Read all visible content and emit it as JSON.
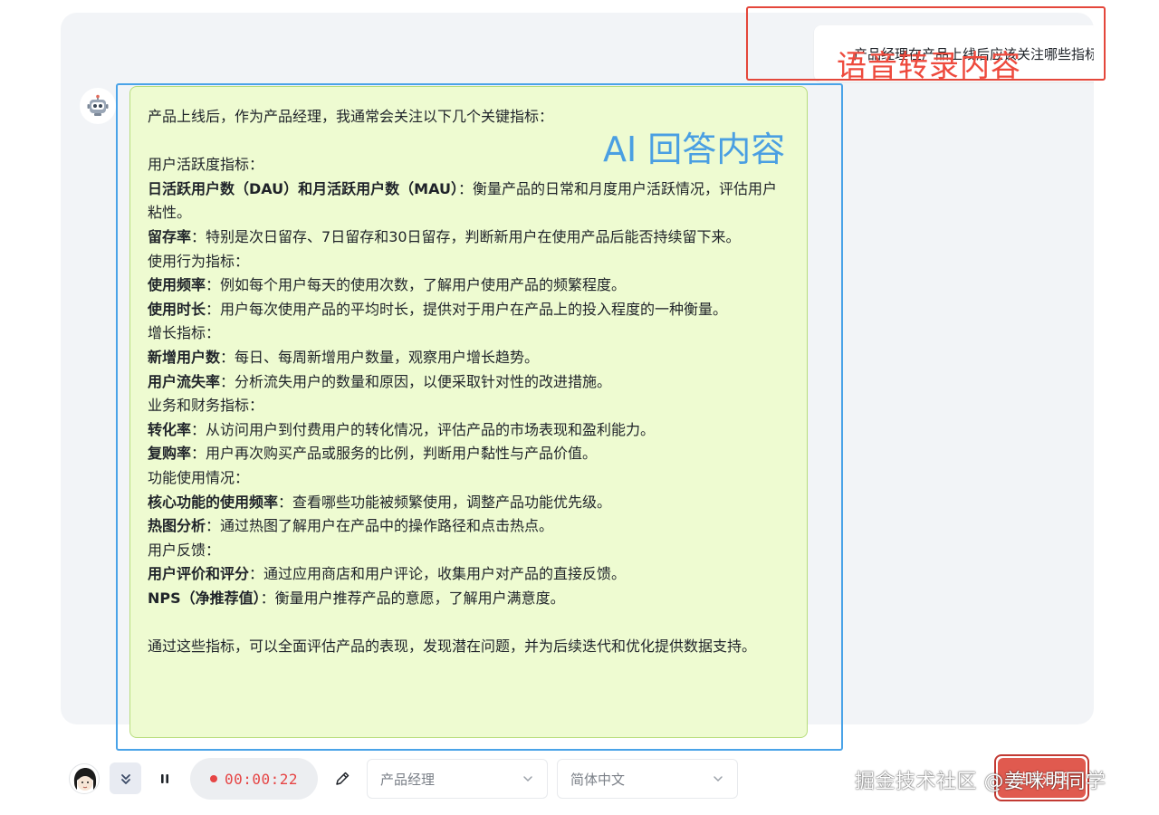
{
  "user_message": "产品经理在产品上线后应该关注哪些指标",
  "annotations": {
    "speech_label": "语音转录内容",
    "ai_label": "AI 回答内容",
    "speech_color": "#e4473b",
    "ai_color": "#4aa3e8"
  },
  "ai_answer": {
    "intro": "产品上线后，作为产品经理，我通常会关注以下几个关键指标：",
    "sections": [
      {
        "heading": "用户活跃度指标：",
        "items": [
          {
            "term": "日活跃用户数（DAU）和月活跃用户数（MAU）",
            "desc": "：衡量产品的日常和月度用户活跃情况，评估用户粘性。"
          },
          {
            "term": "留存率",
            "desc": "：特别是次日留存、7日留存和30日留存，判断新用户在使用产品后能否持续留下来。"
          }
        ]
      },
      {
        "heading": "使用行为指标：",
        "items": [
          {
            "term": "使用频率",
            "desc": "：例如每个用户每天的使用次数，了解用户使用产品的频繁程度。"
          },
          {
            "term": "使用时长",
            "desc": "：用户每次使用产品的平均时长，提供对于用户在产品上的投入程度的一种衡量。"
          }
        ]
      },
      {
        "heading": "增长指标：",
        "items": [
          {
            "term": "新增用户数",
            "desc": "：每日、每周新增用户数量，观察用户增长趋势。"
          },
          {
            "term": "用户流失率",
            "desc": "：分析流失用户的数量和原因，以便采取针对性的改进措施。"
          }
        ]
      },
      {
        "heading": "业务和财务指标：",
        "items": [
          {
            "term": "转化率",
            "desc": "：从访问用户到付费用户的转化情况，评估产品的市场表现和盈利能力。"
          },
          {
            "term": "复购率",
            "desc": "：用户再次购买产品或服务的比例，判断用户黏性与产品价值。"
          }
        ]
      },
      {
        "heading": "功能使用情况：",
        "items": [
          {
            "term": "核心功能的使用频率",
            "desc": "：查看哪些功能被频繁使用，调整产品功能优先级。"
          },
          {
            "term": "热图分析",
            "desc": "：通过热图了解用户在产品中的操作路径和点击热点。"
          }
        ]
      },
      {
        "heading": "用户反馈：",
        "items": [
          {
            "term": "用户评价和评分",
            "desc": "：通过应用商店和用户评论，收集用户对产品的直接反馈。"
          },
          {
            "term": "NPS（净推荐值）",
            "desc": "：衡量用户推荐产品的意愿，了解用户满意度。"
          }
        ]
      }
    ],
    "conclusion": "通过这些指标，可以全面评估产品的表现，发现潜在问题，并为后续迭代和优化提供数据支持。"
  },
  "toolbar": {
    "timer": "00:00:22",
    "role_select": "产品经理",
    "language_select": "简体中文",
    "end_button": "结束对话",
    "icons": [
      "avatar",
      "chevron-double-down-icon",
      "pause-icon",
      "recording-dot-icon",
      "pencil-icon",
      "chevron-down-icon"
    ]
  },
  "watermark": "掘金技术社区 @姜咪明同学",
  "colors": {
    "ai_bubble_bg": "#eefbd1",
    "ai_bubble_border": "#b7dd7c",
    "panel_bg": "#f2f4f7",
    "timer_red": "#e64545",
    "end_button": "#e05a4f"
  }
}
